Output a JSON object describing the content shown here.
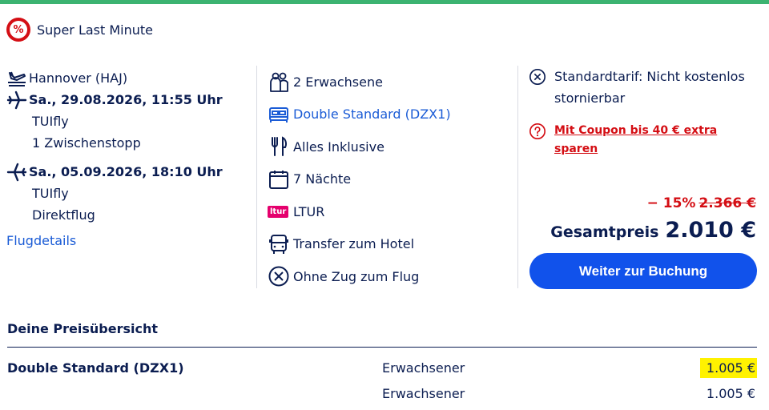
{
  "badge": {
    "label": "Super Last Minute",
    "icon": "percent-icon",
    "color": "#d40e14"
  },
  "flight": {
    "departure_airport": "Hannover (HAJ)",
    "outbound": {
      "datetime": "Sa., 29.08.2026, 11:55 Uhr",
      "airline": "TUIfly",
      "stops": "1 Zwischenstopp"
    },
    "inbound": {
      "datetime": "Sa., 05.09.2026, 18:10 Uhr",
      "airline": "TUIfly",
      "stops": "Direktflug"
    },
    "details_link": "Flugdetails"
  },
  "package": {
    "travellers": "2 Erwachsene",
    "room": "Double Standard (DZX1)",
    "board": "Alles Inklusive",
    "nights": "7 Nächte",
    "operator_logo": "ltur",
    "operator": "LTUR",
    "transfer": "Transfer zum Hotel",
    "train": "Ohne Zug zum Flug"
  },
  "booking": {
    "tariff": "Standardtarif: Nicht kostenlos stornierbar",
    "coupon": "Mit Coupon bis 40 € extra sparen",
    "discount": "− 15%",
    "old_price": "2.366 €",
    "total_label": "Gesamtpreis",
    "total_price": "2.010 €",
    "cta": "Weiter zur Buchung"
  },
  "overview": {
    "title": "Deine Preisübersicht",
    "rows": [
      {
        "name": "Double Standard (DZX1)",
        "type": "Erwachsener",
        "amount": "1.005 €"
      },
      {
        "name": "",
        "type": "Erwachsener",
        "amount": "1.005 €"
      }
    ]
  },
  "colors": {
    "brand_green": "#3cb371",
    "navy": "#0b1d51",
    "link_blue": "#1b5cd6",
    "cta_blue": "#1152eb",
    "alert_red": "#d40e14",
    "highlight": "#fff200"
  }
}
